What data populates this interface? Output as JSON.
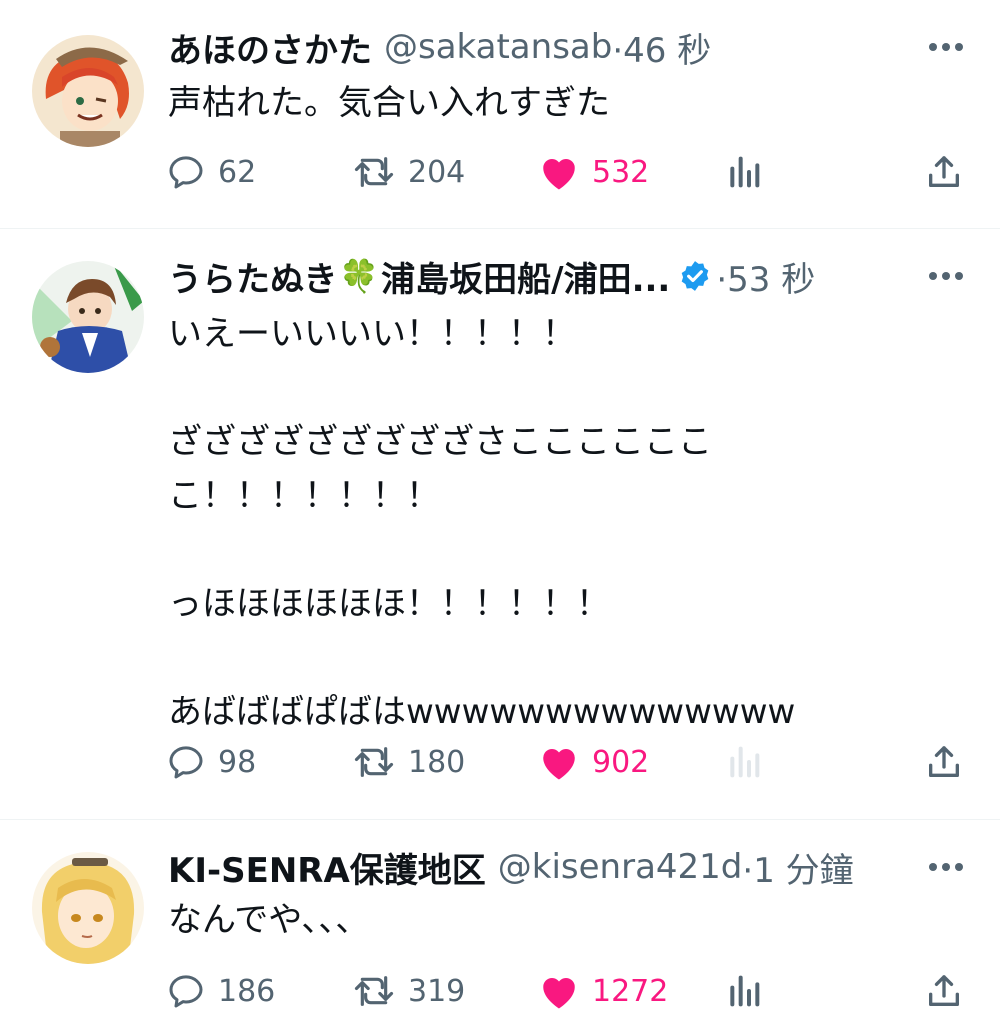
{
  "colors": {
    "like": "#f91880",
    "secondary": "#536471",
    "verified": "#1d9bf0",
    "clover": "#2eab3d"
  },
  "tweets": [
    {
      "name": "あほのさかた",
      "handle": "@sakatansab",
      "time": "·46 秒",
      "text": "声枯れた。気合い入れすぎた",
      "replies": "62",
      "retweets": "204",
      "likes": "532",
      "avatar_icon": "avatar-anime-orange-hair"
    },
    {
      "name": "うらたぬき",
      "name_emoji": "🍀",
      "name_suffix": "浦島坂田船/浦田...",
      "verified": true,
      "time": "·53 秒",
      "text": "いえーいいいい！！！！！\n\nざざざざざざざざざさこここここここ！！！！！！！\n\nっほほほほほほ！！！！！！\n\nあばばばぱばはwwwwwwwwwwwwww",
      "replies": "98",
      "retweets": "180",
      "likes": "902",
      "avatar_icon": "avatar-anime-blue-jacket"
    },
    {
      "name": "KI-SENRA保護地区",
      "handle": "@kisenra421d",
      "time": "·1 分鐘",
      "text": "なんでや、、、",
      "replies": "186",
      "retweets": "319",
      "likes": "1272",
      "avatar_icon": "avatar-anime-blonde"
    }
  ]
}
